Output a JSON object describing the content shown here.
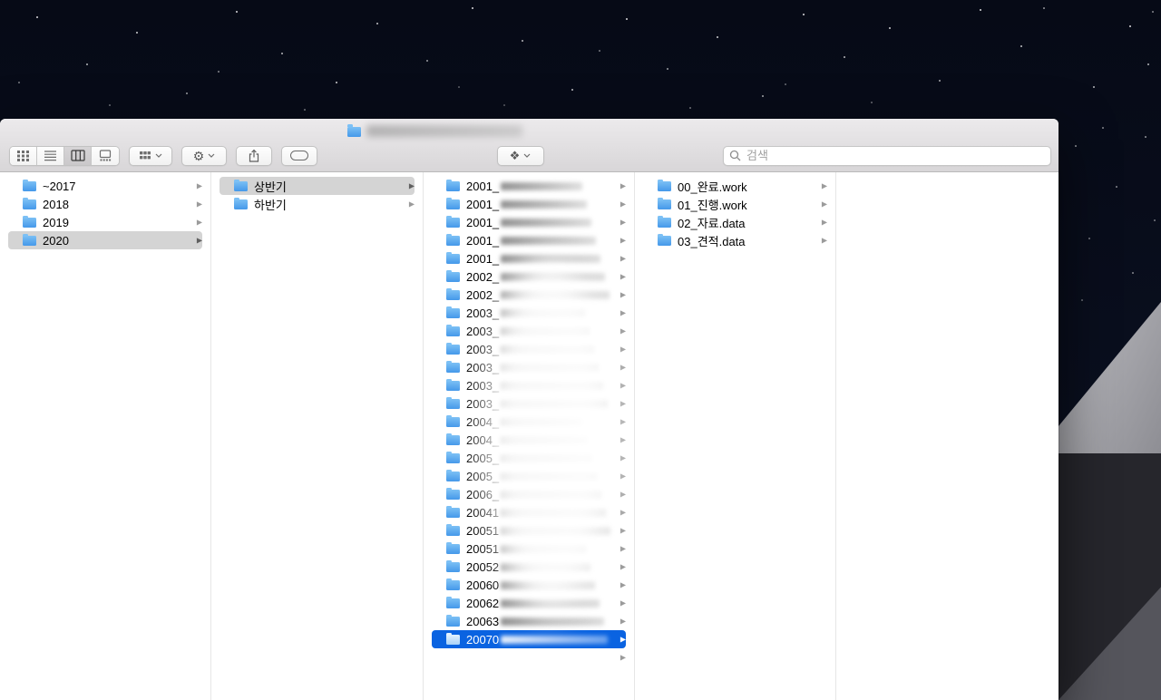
{
  "window": {
    "title_redacted": true,
    "toolbar": {
      "search_placeholder": "검색",
      "icons": {
        "segments": [
          "grid-view-icon",
          "list-view-icon",
          "column-view-icon",
          "gallery-view-icon"
        ],
        "selected_segment": "column-view-icon",
        "group_button": "group-icon",
        "action_button": "gear-icon",
        "share_button": "share-icon",
        "tag_button": "tag-icon",
        "dropbox_button": "dropbox-icon",
        "search": "magnifier-icon",
        "proxy": "folder-icon"
      }
    },
    "columns": [
      {
        "name": "years",
        "items": [
          {
            "label": "~2017"
          },
          {
            "label": "2018"
          },
          {
            "label": "2019"
          },
          {
            "label": "2020",
            "selected": "gray"
          }
        ]
      },
      {
        "name": "half-year",
        "items": [
          {
            "label": "상반기",
            "selected": "gray"
          },
          {
            "label": "하반기"
          }
        ]
      },
      {
        "name": "projects",
        "items": [
          {
            "label": "2001_",
            "redacted": true
          },
          {
            "label": "2001_",
            "redacted": true
          },
          {
            "label": "2001_",
            "redacted": true
          },
          {
            "label": "2001_",
            "redacted": true
          },
          {
            "label": "2001_",
            "redacted": true
          },
          {
            "label": "2002_",
            "redacted": true
          },
          {
            "label": "2002_",
            "redacted": true
          },
          {
            "label": "2003_",
            "redacted": true
          },
          {
            "label": "2003_",
            "redacted": true
          },
          {
            "label": "2003_",
            "redacted": true
          },
          {
            "label": "2003_",
            "redacted": true
          },
          {
            "label": "2003_",
            "redacted": true
          },
          {
            "label": "2003_",
            "redacted": true
          },
          {
            "label": "2004_",
            "redacted": true
          },
          {
            "label": "2004_",
            "redacted": true
          },
          {
            "label": "2005_",
            "redacted": true
          },
          {
            "label": "2005_",
            "redacted": true
          },
          {
            "label": "2006_",
            "redacted": true
          },
          {
            "label": "20041",
            "redacted": true
          },
          {
            "label": "20051",
            "redacted": true
          },
          {
            "label": "20051",
            "redacted": true
          },
          {
            "label": "20052",
            "redacted": true
          },
          {
            "label": "20060",
            "redacted": true
          },
          {
            "label": "20062",
            "redacted": true
          },
          {
            "label": "20063",
            "redacted": true
          },
          {
            "label": "20070",
            "redacted": true,
            "selected": "blue"
          },
          {
            "label": "",
            "redacted": true,
            "name_fully_hidden": true
          }
        ]
      },
      {
        "name": "categories",
        "items": [
          {
            "label": "00_완료.work"
          },
          {
            "label": "01_진행.work"
          },
          {
            "label": "02_자료.data"
          },
          {
            "label": "03_견적.data"
          }
        ]
      },
      {
        "name": "empty",
        "items": []
      }
    ]
  },
  "colors": {
    "selection_blue": "#0a63e1",
    "selection_gray": "#d4d4d4",
    "folder_blue": "#4aa3f2"
  }
}
